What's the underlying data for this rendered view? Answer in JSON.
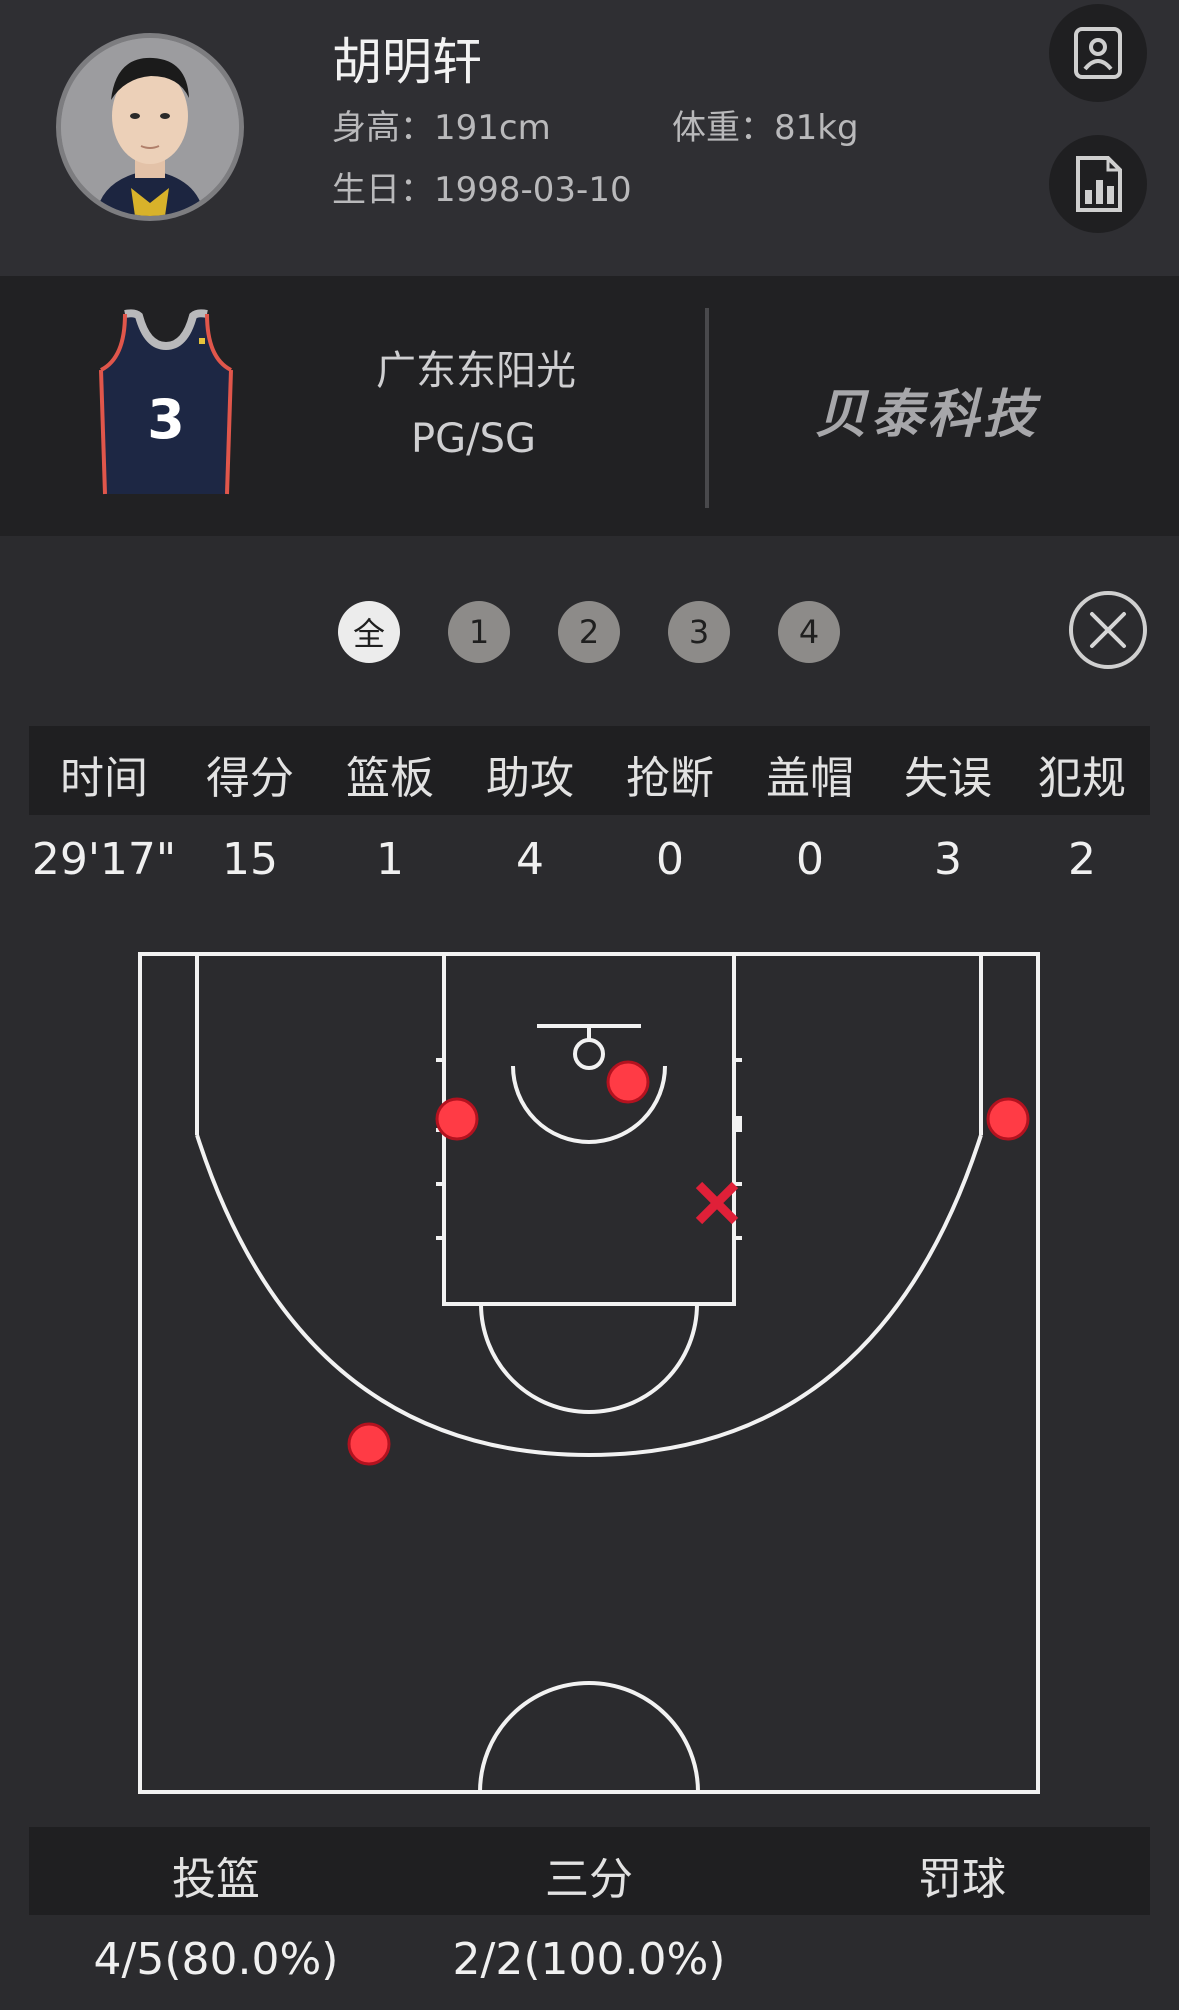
{
  "player": {
    "name": "胡明轩",
    "height": "身高：191cm",
    "weight": "体重：81kg",
    "birthday": "生日：1998-03-10",
    "jersey_number": "3",
    "team": "广东东阳光",
    "position": "PG/SG"
  },
  "brand": "贝泰科技",
  "header_buttons": [
    "profile-icon",
    "stats-chart-icon"
  ],
  "quarter_tabs": {
    "items": [
      "全",
      "1",
      "2",
      "3",
      "4"
    ],
    "selected": "全"
  },
  "stats": {
    "headers": [
      "时间",
      "得分",
      "篮板",
      "助攻",
      "抢断",
      "盖帽",
      "失误",
      "犯规"
    ],
    "values": [
      "29'17\"",
      "15",
      "1",
      "4",
      "0",
      "0",
      "3",
      "2"
    ]
  },
  "shooting": {
    "headers": [
      "投篮",
      "三分",
      "罚球"
    ],
    "values": [
      "4/5(80.0%)",
      "2/2(100.0%)",
      ""
    ]
  },
  "shot_chart": {
    "made_color": "#ff3b45",
    "missed_color": "#e02038",
    "shots": [
      {
        "result": "made",
        "zone": "paint-left"
      },
      {
        "result": "made",
        "zone": "restricted-area"
      },
      {
        "result": "made",
        "zone": "right-corner-three"
      },
      {
        "result": "missed",
        "zone": "paint-right"
      },
      {
        "result": "made",
        "zone": "left-wing-three"
      }
    ]
  },
  "colors": {
    "background": "#2b2b2e",
    "header": "#2f2f33",
    "band": "#212123",
    "court_lines": "#f2f2f2"
  }
}
